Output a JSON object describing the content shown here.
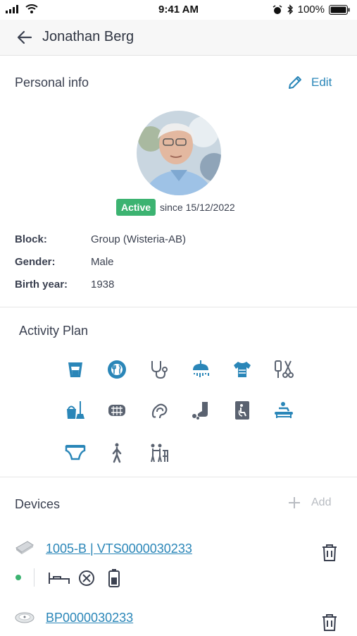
{
  "status_bar": {
    "time": "9:41 AM",
    "battery": "100%"
  },
  "header": {
    "title": "Jonathan Berg"
  },
  "personal_info": {
    "section_title": "Personal info",
    "edit_label": "Edit",
    "status_badge": "Active",
    "since_text": "since 15/12/2022",
    "fields": [
      {
        "label": "Block:",
        "value": "Group (Wisteria-AB)"
      },
      {
        "label": "Gender:",
        "value": "Male"
      },
      {
        "label": "Birth year:",
        "value": "1938"
      }
    ]
  },
  "activity_plan": {
    "section_title": "Activity Plan",
    "icons": [
      "drink-icon",
      "meal-icon",
      "stethoscope-icon",
      "shower-icon",
      "clothing-icon",
      "nail-care-icon",
      "cleaning-icon",
      "dentures-icon",
      "hearing-aid-icon",
      "footwear-icon",
      "toilet-icon",
      "massage-icon",
      "diaper-icon",
      "walking-icon",
      "walker-assistance-icon"
    ]
  },
  "devices": {
    "section_title": "Devices",
    "add_label": "Add",
    "items": [
      {
        "name": "1005-B | VTS0000030233",
        "icon": "sensor-pad-icon"
      },
      {
        "name": "BP0000030233",
        "icon": "blood-pressure-device-icon"
      }
    ]
  },
  "colors": {
    "accent": "#2a86b8",
    "active": "#3cb371",
    "icon_blue": "#2a86b8",
    "icon_gray": "#5a6270"
  }
}
